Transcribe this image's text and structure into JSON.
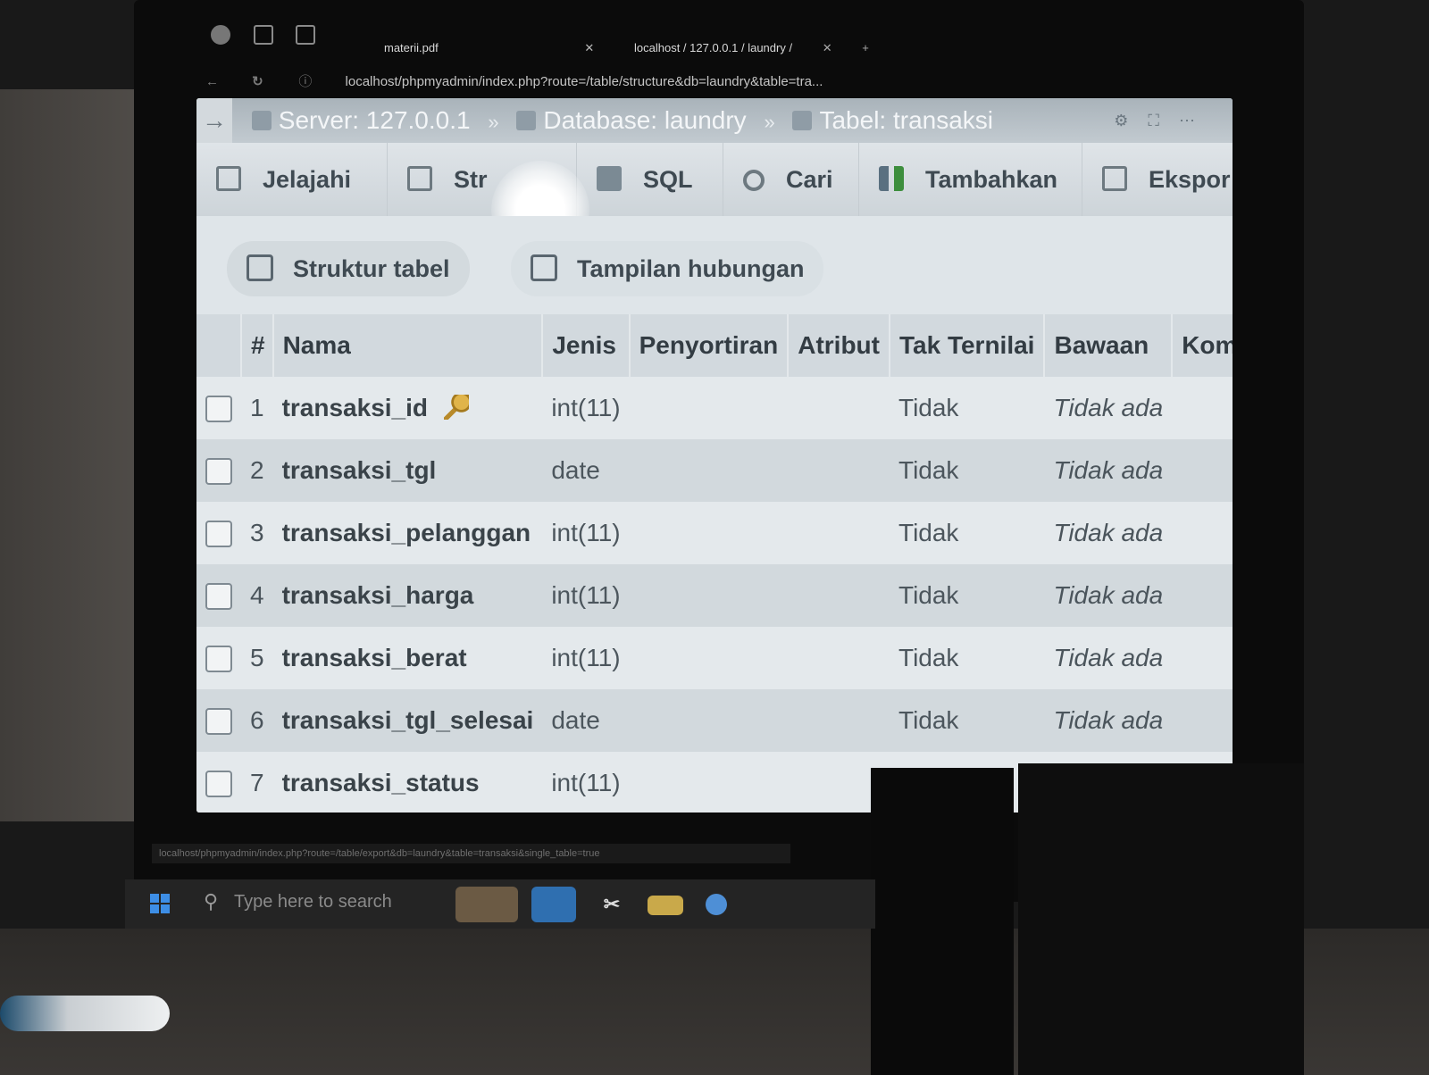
{
  "browser": {
    "tabs": [
      {
        "label": "materii.pdf"
      },
      {
        "label": "localhost / 127.0.0.1 / laundry /"
      }
    ],
    "url": "localhost/phpmyadmin/index.php?route=/table/structure&db=laundry&table=tra..."
  },
  "breadcrumb": {
    "server": "Server: 127.0.0.1",
    "database": "Database: laundry",
    "table": "Tabel: transaksi",
    "sep": "»"
  },
  "menu": {
    "items": [
      {
        "label": "Jelajahi",
        "icon": "browse-icon"
      },
      {
        "label": "Str",
        "icon": "structure-icon"
      },
      {
        "label": "SQL",
        "icon": "sql-icon"
      },
      {
        "label": "Cari",
        "icon": "search-icon"
      },
      {
        "label": "Tambahkan",
        "icon": "insert-icon"
      },
      {
        "label": "Ekspor",
        "icon": "export-icon"
      }
    ]
  },
  "subtabs": {
    "structure": "Struktur tabel",
    "relation": "Tampilan hubungan"
  },
  "table": {
    "headers": {
      "num": "#",
      "name": "Nama",
      "type": "Jenis",
      "collation": "Penyortiran",
      "attributes": "Atribut",
      "null": "Tak Ternilai",
      "default": "Bawaan",
      "comments": "Kom"
    },
    "rows": [
      {
        "num": "1",
        "name": "transaksi_id",
        "type": "int(11)",
        "null": "Tidak",
        "default": "Tidak ada",
        "primary": true
      },
      {
        "num": "2",
        "name": "transaksi_tgl",
        "type": "date",
        "null": "Tidak",
        "default": "Tidak ada"
      },
      {
        "num": "3",
        "name": "transaksi_pelanggan",
        "type": "int(11)",
        "null": "Tidak",
        "default": "Tidak ada"
      },
      {
        "num": "4",
        "name": "transaksi_harga",
        "type": "int(11)",
        "null": "Tidak",
        "default": "Tidak ada"
      },
      {
        "num": "5",
        "name": "transaksi_berat",
        "type": "int(11)",
        "null": "Tidak",
        "default": "Tidak ada"
      },
      {
        "num": "6",
        "name": "transaksi_tgl_selesai",
        "type": "date",
        "null": "Tidak",
        "default": "Tidak ada"
      },
      {
        "num": "7",
        "name": "transaksi_status",
        "type": "int(11)",
        "null": "",
        "default": ""
      }
    ]
  },
  "status_url": "localhost/phpmyadmin/index.php?route=/table/export&db=laundry&table=transaksi&single_table=true",
  "taskbar": {
    "search_placeholder": "Type here to search"
  }
}
